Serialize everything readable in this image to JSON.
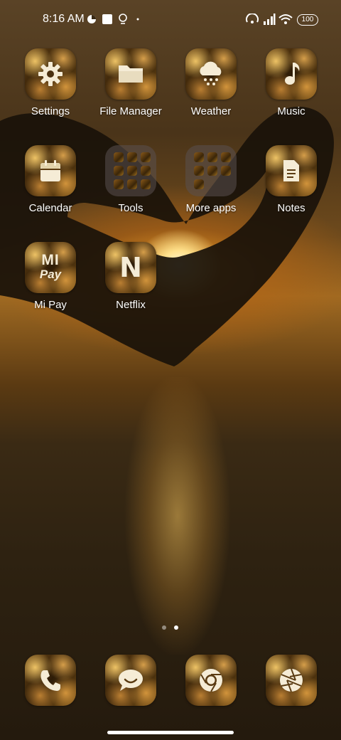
{
  "status_bar": {
    "time": "8:16 AM",
    "battery": "100",
    "left_icons": [
      "app-notification-icon",
      "square-notification-icon",
      "bulb-notification-icon",
      "dot-icon"
    ],
    "right_icons": [
      "hotspot-icon",
      "cellular-signal-icon",
      "wifi-icon",
      "battery-icon"
    ]
  },
  "apps": [
    {
      "label": "Settings",
      "icon": "gear-icon"
    },
    {
      "label": "File Manager",
      "icon": "folder-icon"
    },
    {
      "label": "Weather",
      "icon": "cloud-rain-icon"
    },
    {
      "label": "Music",
      "icon": "music-note-icon"
    },
    {
      "label": "Calendar",
      "icon": "calendar-icon"
    },
    {
      "label": "Tools",
      "icon": "folder-group"
    },
    {
      "label": "More apps",
      "icon": "folder-group"
    },
    {
      "label": "Notes",
      "icon": "notes-icon"
    },
    {
      "label": "Mi Pay",
      "icon": "mi-pay-icon",
      "icon_text_top": "MI",
      "icon_text_bottom": "Pay"
    },
    {
      "label": "Netflix",
      "icon": "netflix-icon",
      "icon_text": "N"
    }
  ],
  "dock": [
    {
      "icon": "phone-icon"
    },
    {
      "icon": "messages-icon"
    },
    {
      "icon": "chrome-icon"
    },
    {
      "icon": "camera-shutter-icon"
    }
  ],
  "pages": {
    "count": 2,
    "active": 2
  }
}
